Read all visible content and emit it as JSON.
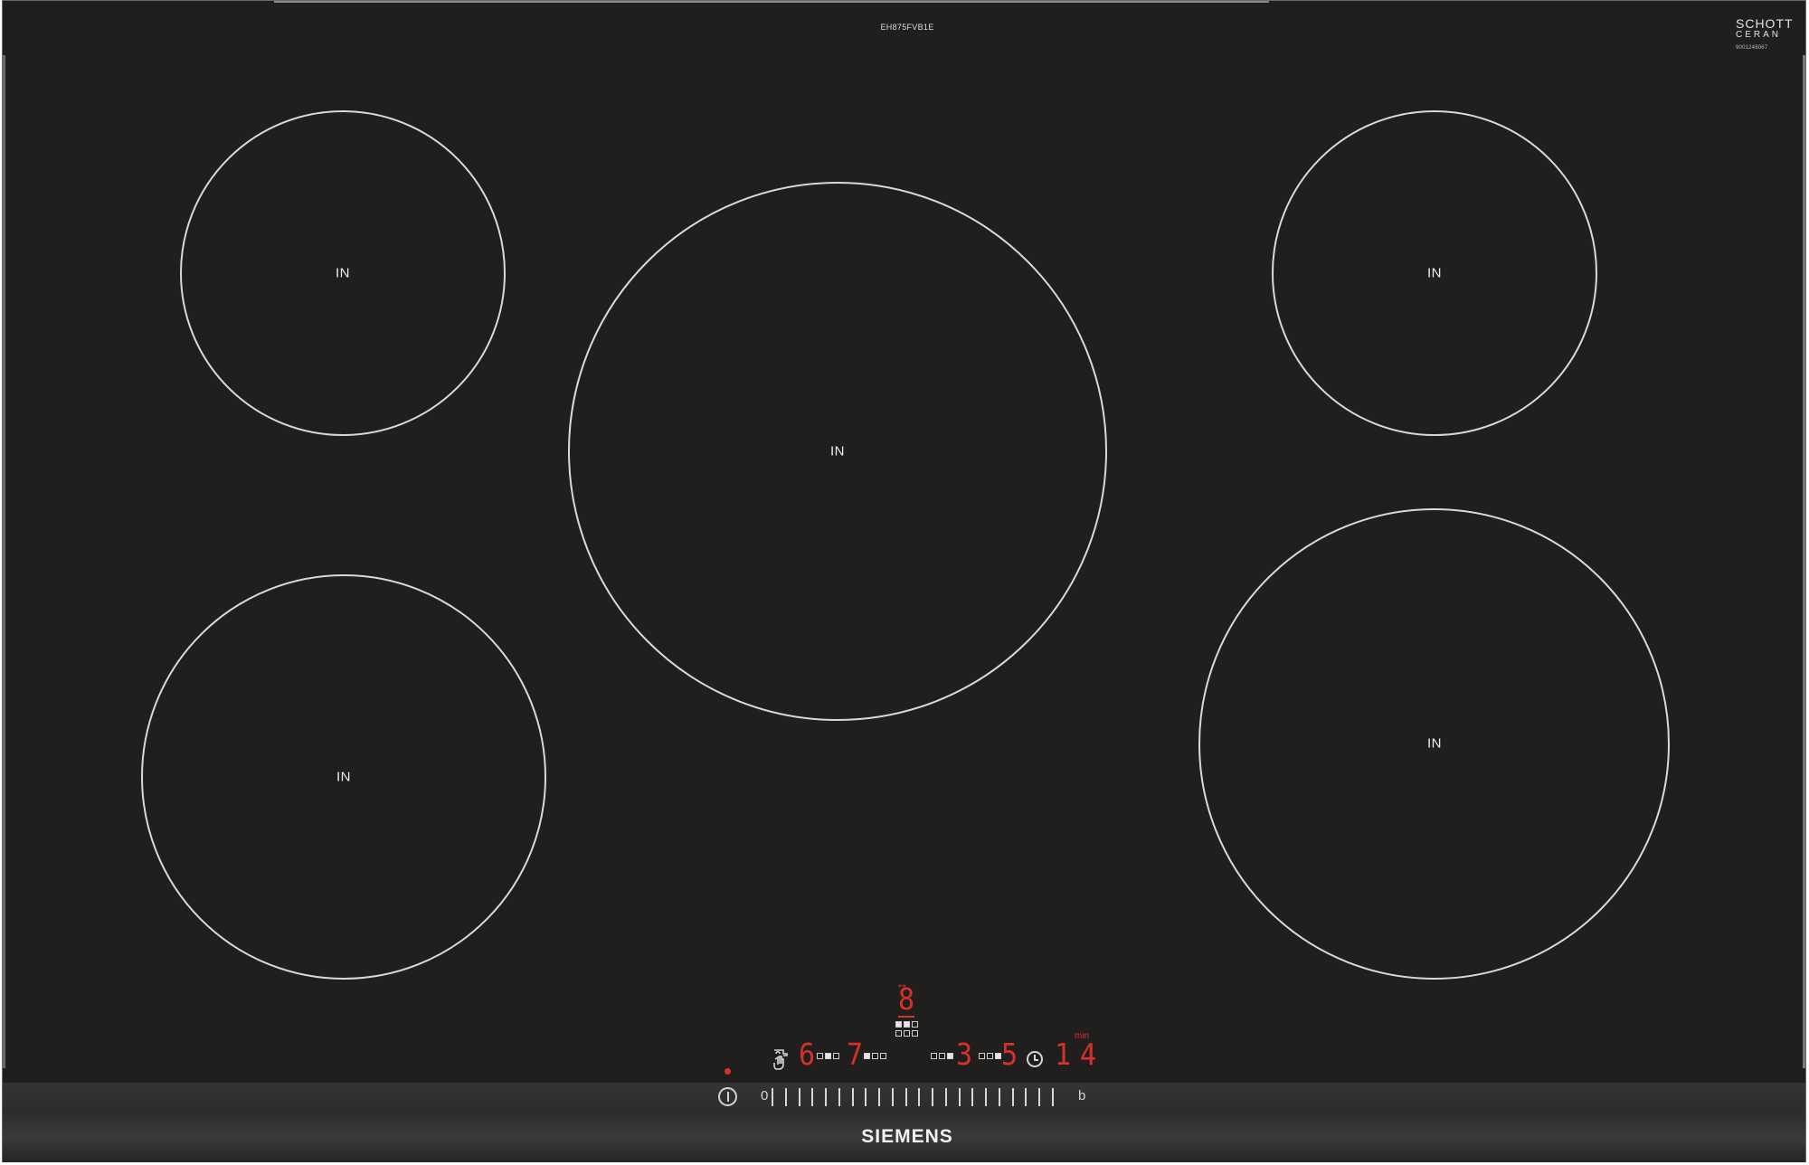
{
  "device": {
    "model": "EH875FVB1E",
    "glass_brand_line1": "SCHOTT",
    "glass_brand_line2": "CERAN",
    "glass_serial": "9001248067",
    "brand": "SIEMENS",
    "colors": {
      "glass": "#201f1e",
      "ring": "#d9d9d9",
      "display_red": "#d8312a"
    }
  },
  "zones": [
    {
      "id": "front-left-back",
      "label": "IN"
    },
    {
      "id": "center",
      "label": "IN"
    },
    {
      "id": "back-right",
      "label": "IN"
    },
    {
      "id": "front-left",
      "label": "IN"
    },
    {
      "id": "front-right",
      "label": "IN"
    }
  ],
  "display": {
    "zone_left_level": "6",
    "zone_left_rear_level": "7",
    "center_level": "8",
    "zone_right_rear_level": "3",
    "zone_right_level": "5",
    "timer_value": "14",
    "timer_unit": "min"
  },
  "controls": {
    "power_icon": "power-icon",
    "lock_icon": "child-lock-icon",
    "slider_min_label": "0",
    "slider_max_label": "b"
  }
}
